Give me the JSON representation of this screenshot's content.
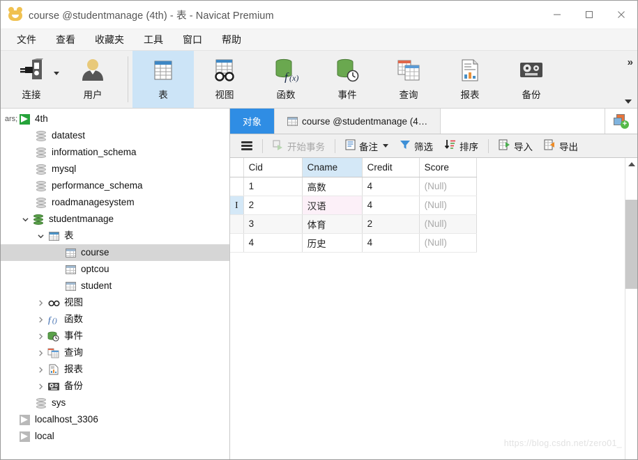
{
  "window": {
    "title": "course @studentmanage (4th) - 表 - Navicat Premium",
    "app_icon": "navicat-logo-icon",
    "minimize": "–",
    "maximize": "□",
    "close": "✕"
  },
  "menubar": {
    "items": [
      {
        "label": "文件"
      },
      {
        "label": "查看"
      },
      {
        "label": "收藏夹"
      },
      {
        "label": "工具"
      },
      {
        "label": "窗口"
      },
      {
        "label": "帮助"
      }
    ]
  },
  "toolbar": {
    "overflow_label": "»",
    "items": [
      {
        "label": "连接",
        "icon": "connection-icon",
        "active": false,
        "has_caret": true
      },
      {
        "label": "用户",
        "icon": "user-icon",
        "active": false,
        "has_caret": false
      },
      {
        "label": "表",
        "icon": "table-icon",
        "active": true,
        "has_caret": false
      },
      {
        "label": "视图",
        "icon": "view-icon",
        "active": false,
        "has_caret": false
      },
      {
        "label": "函数",
        "icon": "function-icon",
        "active": false,
        "has_caret": false
      },
      {
        "label": "事件",
        "icon": "event-icon",
        "active": false,
        "has_caret": false
      },
      {
        "label": "查询",
        "icon": "query-icon",
        "active": false,
        "has_caret": false
      },
      {
        "label": "报表",
        "icon": "report-icon",
        "active": false,
        "has_caret": false
      },
      {
        "label": "备份",
        "icon": "backup-icon",
        "active": false,
        "has_caret": false
      }
    ]
  },
  "sidebar": {
    "tree": [
      {
        "label": "4th",
        "depth": 0,
        "icon": "connection-icon",
        "twisty": "expanded",
        "selected": false
      },
      {
        "label": "datatest",
        "depth": 1,
        "icon": "database-closed-icon",
        "twisty": "none",
        "selected": false
      },
      {
        "label": "information_schema",
        "depth": 1,
        "icon": "database-closed-icon",
        "twisty": "none",
        "selected": false
      },
      {
        "label": "mysql",
        "depth": 1,
        "icon": "database-closed-icon",
        "twisty": "none",
        "selected": false
      },
      {
        "label": "performance_schema",
        "depth": 1,
        "icon": "database-closed-icon",
        "twisty": "none",
        "selected": false
      },
      {
        "label": "roadmanagesystem",
        "depth": 1,
        "icon": "database-closed-icon",
        "twisty": "none",
        "selected": false
      },
      {
        "label": "studentmanage",
        "depth": 1,
        "icon": "database-open-icon",
        "twisty": "expanded",
        "selected": false
      },
      {
        "label": "表",
        "depth": 2,
        "icon": "table-folder-icon",
        "twisty": "expanded",
        "selected": false
      },
      {
        "label": "course",
        "depth": 3,
        "icon": "table-icon",
        "twisty": "none",
        "selected": true
      },
      {
        "label": "optcou",
        "depth": 3,
        "icon": "table-icon",
        "twisty": "none",
        "selected": false
      },
      {
        "label": "student",
        "depth": 3,
        "icon": "table-icon",
        "twisty": "none",
        "selected": false
      },
      {
        "label": "视图",
        "depth": 2,
        "icon": "view-icon",
        "twisty": "collapsed",
        "selected": false
      },
      {
        "label": "函数",
        "depth": 2,
        "icon": "function-icon",
        "twisty": "collapsed",
        "selected": false
      },
      {
        "label": "事件",
        "depth": 2,
        "icon": "event-icon",
        "twisty": "collapsed",
        "selected": false
      },
      {
        "label": "查询",
        "depth": 2,
        "icon": "query-icon",
        "twisty": "collapsed",
        "selected": false
      },
      {
        "label": "报表",
        "depth": 2,
        "icon": "report-icon",
        "twisty": "collapsed",
        "selected": false
      },
      {
        "label": "备份",
        "depth": 2,
        "icon": "backup-icon",
        "twisty": "collapsed",
        "selected": false
      },
      {
        "label": "sys",
        "depth": 1,
        "icon": "database-closed-icon",
        "twisty": "none",
        "selected": false
      },
      {
        "label": "localhost_3306",
        "depth": 0,
        "icon": "connection-gray-icon",
        "twisty": "none",
        "selected": false
      },
      {
        "label": "local",
        "depth": 0,
        "icon": "connection-gray-icon",
        "twisty": "none",
        "selected": false
      }
    ]
  },
  "main": {
    "tabs": [
      {
        "label": "对象",
        "active": true,
        "icon": null
      },
      {
        "label": "course @studentmanage (4…",
        "active": false,
        "icon": "table-icon"
      }
    ],
    "new_tab_button": "new-object-button",
    "actions": [
      {
        "label": "开始事务",
        "icon": "transaction-icon",
        "disabled": true,
        "caret": false
      },
      {
        "label": "备注",
        "icon": "note-icon",
        "disabled": false,
        "caret": true
      },
      {
        "label": "筛选",
        "icon": "filter-icon",
        "disabled": false,
        "caret": false
      },
      {
        "label": "排序",
        "icon": "sort-icon",
        "disabled": false,
        "caret": false
      },
      {
        "label": "导入",
        "icon": "import-icon",
        "disabled": false,
        "caret": false
      },
      {
        "label": "导出",
        "icon": "export-icon",
        "disabled": false,
        "caret": false
      }
    ]
  },
  "table_data": {
    "columns": [
      {
        "key": "cid",
        "label": "Cid",
        "align": "right",
        "highlighted": false
      },
      {
        "key": "cname",
        "label": "Cname",
        "align": "left",
        "highlighted": true
      },
      {
        "key": "credit",
        "label": "Credit",
        "align": "right",
        "highlighted": false
      },
      {
        "key": "score",
        "label": "Score",
        "align": "left",
        "highlighted": false
      }
    ],
    "rows": [
      {
        "cid": "1",
        "cname": "高数",
        "credit": "4",
        "score": "(Null)",
        "selected": false
      },
      {
        "cid": "2",
        "cname": "汉语",
        "credit": "4",
        "score": "(Null)",
        "selected": true
      },
      {
        "cid": "3",
        "cname": "体育",
        "credit": "2",
        "score": "(Null)",
        "selected": false
      },
      {
        "cid": "4",
        "cname": "历史",
        "credit": "4",
        "score": "(Null)",
        "selected": false
      }
    ],
    "null_text": "(Null)",
    "cursor_glyph": "I"
  },
  "scrollbar": {
    "up_arrow": "scroll-up-arrow"
  },
  "watermark": {
    "text": "https://blog.csdn.net/zero01_"
  },
  "colors": {
    "accent_blue": "#2f8de4",
    "toolbar_active": "#cce4f7",
    "header_highlight": "#d4e8f7",
    "cell_selected": "#fcf0f8",
    "tree_selected": "#d6d6d6",
    "db_green": "#5aa04a",
    "import_green": "#54b948",
    "export_orange": "#e8743b"
  }
}
